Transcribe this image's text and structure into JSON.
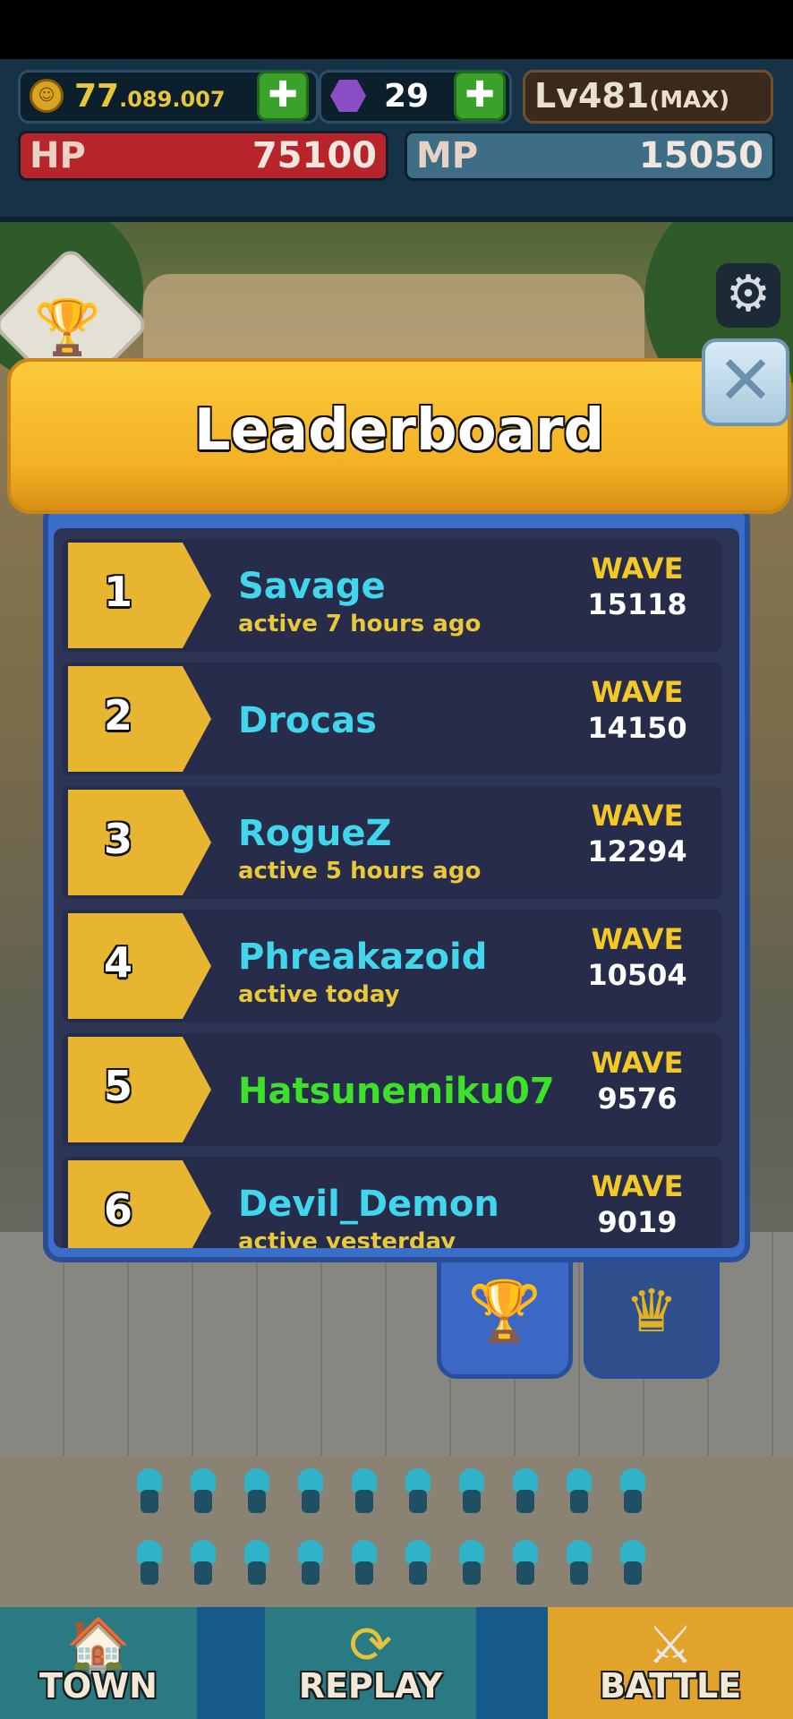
{
  "hud": {
    "coins_main": "77",
    "coins_small": ".089.007",
    "gems": "29",
    "level_main": "Lv481",
    "level_max": "(MAX)",
    "hp_label": "HP",
    "hp_value": "75100",
    "mp_label": "MP",
    "mp_value": "15050",
    "plus_glyph": "✚"
  },
  "leaderboard": {
    "title": "Leaderboard",
    "close_glyph": "✕",
    "wave_label": "WAVE",
    "entries": [
      {
        "rank": "1",
        "name": "Savage",
        "activity": "active 7 hours ago",
        "wave": "15118"
      },
      {
        "rank": "2",
        "name": "Drocas",
        "activity": "",
        "wave": "14150"
      },
      {
        "rank": "3",
        "name": "RogueZ",
        "activity": "active 5 hours ago",
        "wave": "12294"
      },
      {
        "rank": "4",
        "name": "Phreakazoid",
        "activity": "active today",
        "wave": "10504"
      },
      {
        "rank": "5",
        "name": "Hatsunemiku07",
        "activity": "",
        "wave": "9576"
      },
      {
        "rank": "6",
        "name": "Devil_Demon",
        "activity": "active yesterday",
        "wave": "9019"
      }
    ]
  },
  "tabs": {
    "trophy_glyph": "🏆",
    "crown_glyph": "♛"
  },
  "side": {
    "gear_glyph": "⚙",
    "trophy_glyph": "🏆"
  },
  "nav": {
    "town_label": "TOWN",
    "replay_label": "REPLAY",
    "battle_label": "BATTLE",
    "town_glyph": "🏠",
    "replay_glyph": "⟳",
    "battle_glyph": "⚔"
  },
  "colors": {
    "panel_header": "#f3b124",
    "panel_body": "#3a6ec8",
    "name_cyan": "#41d6ec",
    "name_green": "#3ee02a",
    "wave_yellow": "#f3c827"
  }
}
